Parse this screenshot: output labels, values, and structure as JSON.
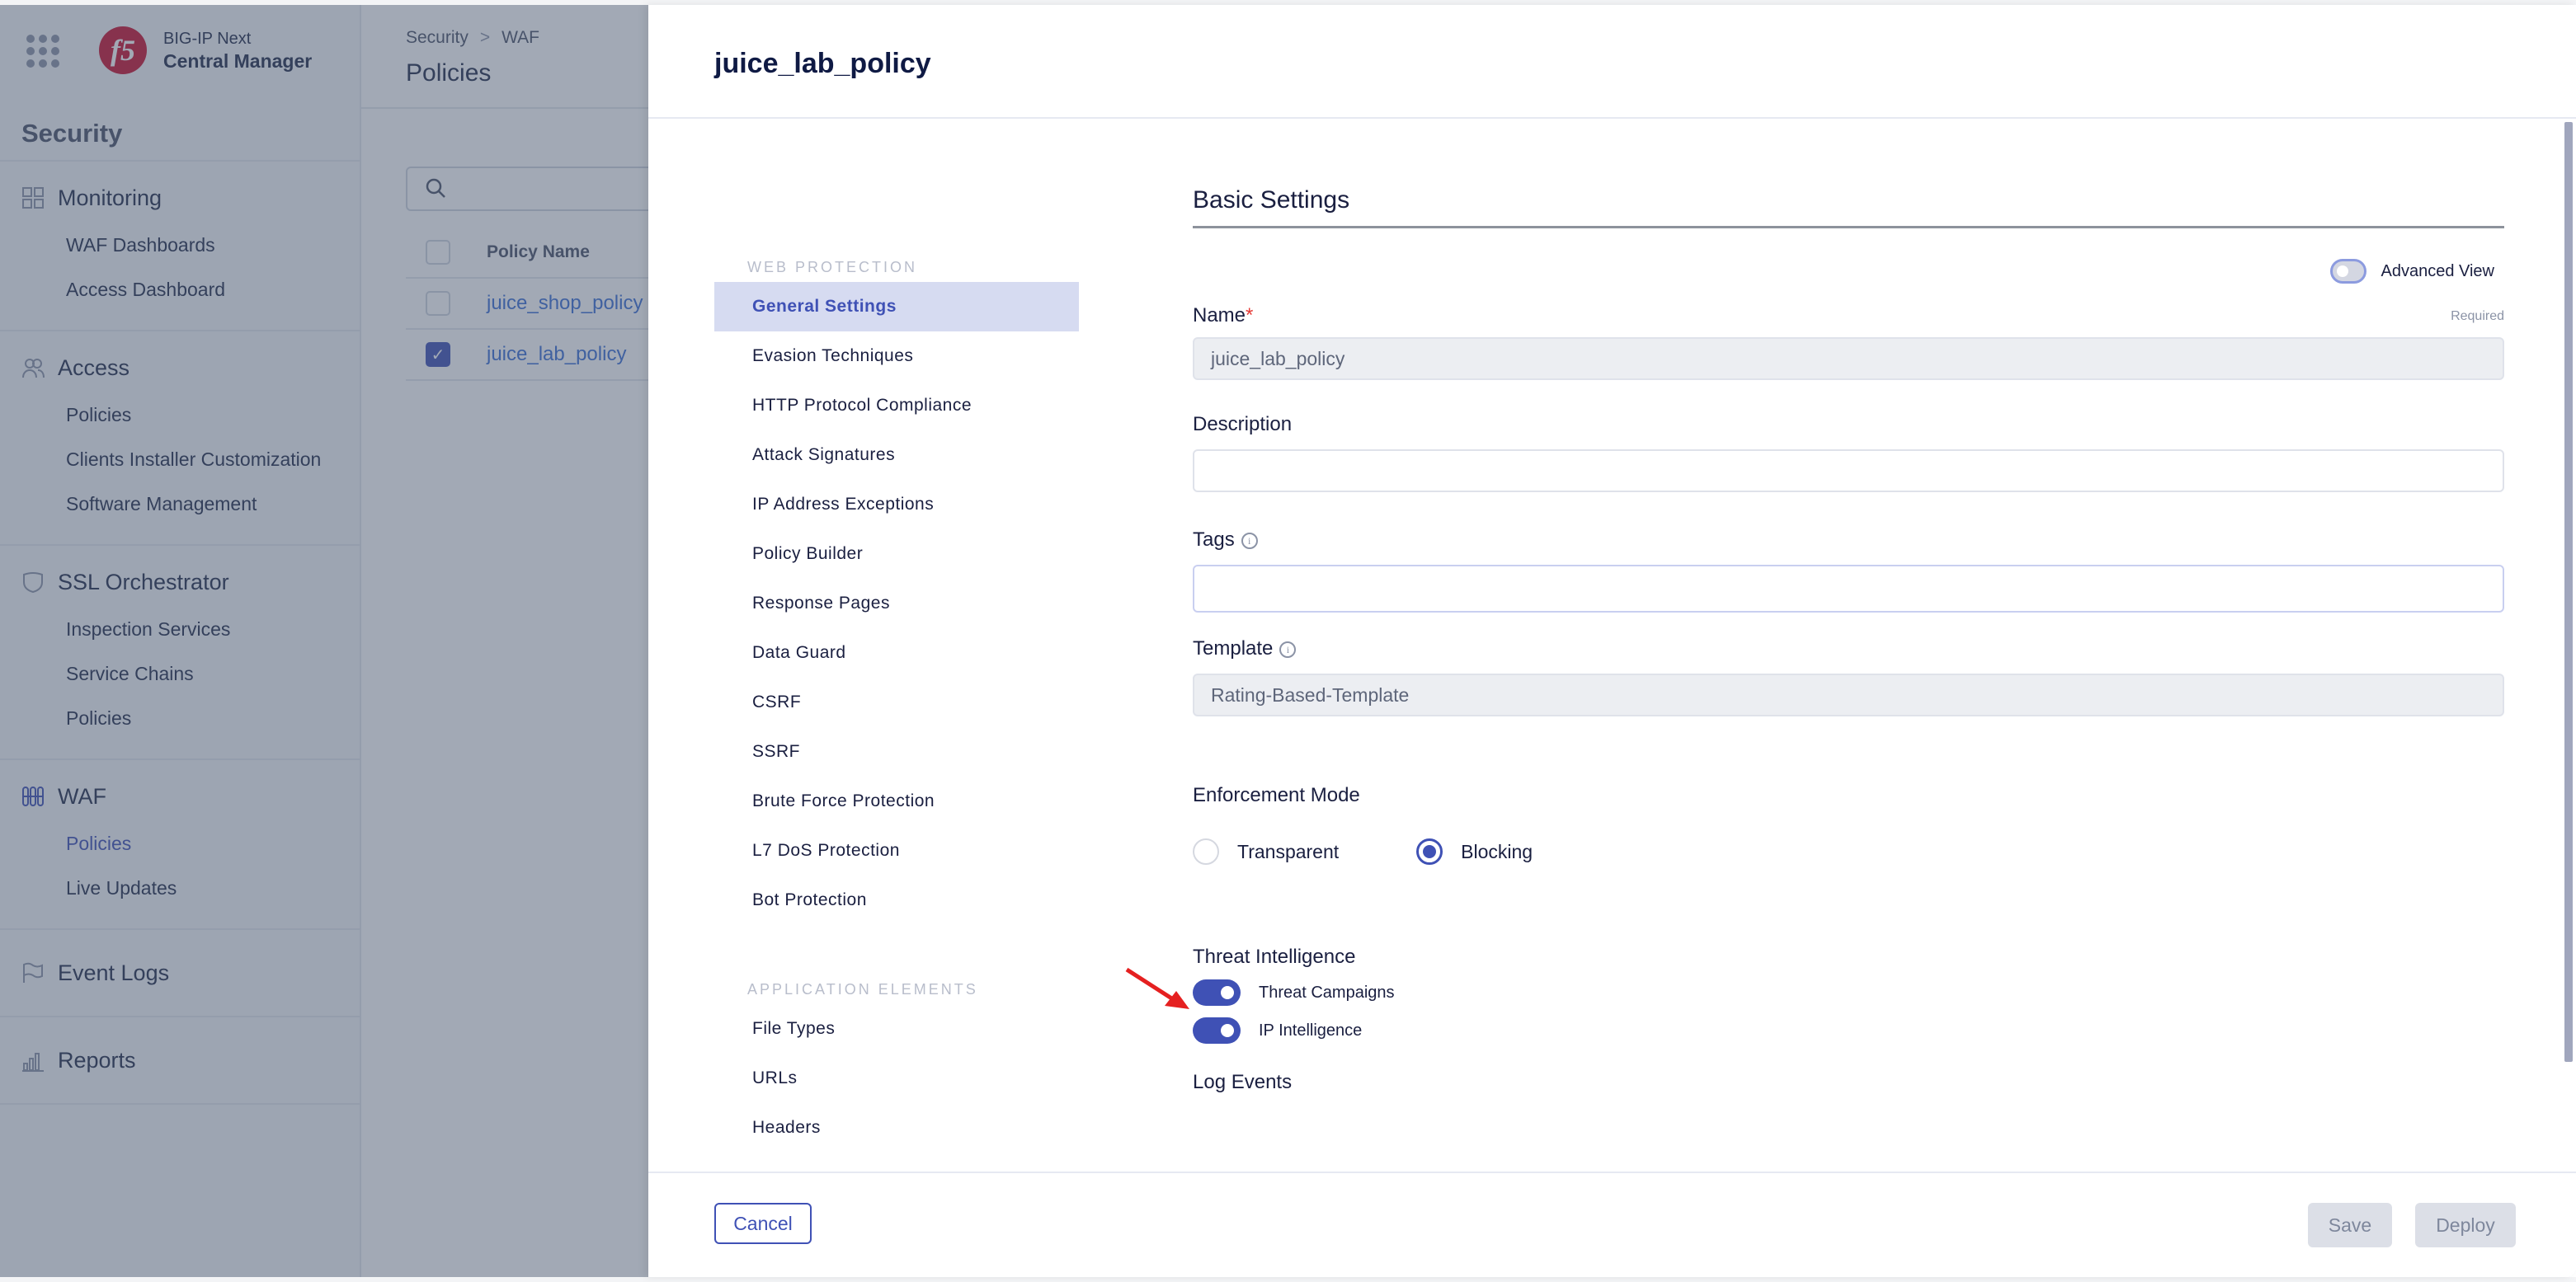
{
  "brand": {
    "line1": "BIG-IP Next",
    "line2": "Central Manager",
    "logo": "f5"
  },
  "sidebar": {
    "section_title": "Security",
    "groups": [
      {
        "label": "Monitoring",
        "icon": "grid-icon",
        "items": [
          {
            "label": "WAF Dashboards"
          },
          {
            "label": "Access Dashboard"
          }
        ]
      },
      {
        "label": "Access",
        "icon": "users-icon",
        "items": [
          {
            "label": "Policies"
          },
          {
            "label": "Clients Installer Customization"
          },
          {
            "label": "Software Management"
          }
        ]
      },
      {
        "label": "SSL Orchestrator",
        "icon": "shield-icon",
        "items": [
          {
            "label": "Inspection Services"
          },
          {
            "label": "Service Chains"
          },
          {
            "label": "Policies"
          }
        ]
      },
      {
        "label": "WAF",
        "icon": "waf-icon",
        "items": [
          {
            "label": "Policies",
            "active": true
          },
          {
            "label": "Live Updates"
          }
        ]
      },
      {
        "label": "Event Logs",
        "icon": "flag-icon",
        "items": []
      },
      {
        "label": "Reports",
        "icon": "bar-chart-icon",
        "items": []
      }
    ]
  },
  "page": {
    "breadcrumb": [
      "Security",
      "WAF"
    ],
    "breadcrumb_sep": ">",
    "title": "Policies",
    "search_placeholder": "",
    "table": {
      "header": "Policy Name",
      "rows": [
        {
          "name": "juice_shop_policy",
          "checked": false
        },
        {
          "name": "juice_lab_policy",
          "checked": true
        }
      ]
    }
  },
  "panel": {
    "title": "juice_lab_policy",
    "nav": {
      "web_protection_label": "WEB PROTECTION",
      "web_protection": [
        "General Settings",
        "Evasion Techniques",
        "HTTP Protocol Compliance",
        "Attack Signatures",
        "IP Address Exceptions",
        "Policy Builder",
        "Response Pages",
        "Data Guard",
        "CSRF",
        "SSRF",
        "Brute Force Protection",
        "L7 DoS Protection",
        "Bot Protection"
      ],
      "active": "General Settings",
      "application_elements_label": "APPLICATION ELEMENTS",
      "application_elements": [
        "File Types",
        "URLs",
        "Headers"
      ]
    },
    "section_title": "Basic Settings",
    "advanced_view": {
      "label": "Advanced View",
      "on": false
    },
    "name": {
      "label": "Name",
      "required_mark": "*",
      "required_text": "Required",
      "value": "juice_lab_policy"
    },
    "description": {
      "label": "Description",
      "value": ""
    },
    "tags": {
      "label": "Tags",
      "value": ""
    },
    "template": {
      "label": "Template",
      "value": "Rating-Based-Template"
    },
    "enforcement": {
      "label": "Enforcement Mode",
      "options": [
        "Transparent",
        "Blocking"
      ],
      "selected": "Blocking"
    },
    "threat_intel": {
      "label": "Threat Intelligence",
      "toggles": [
        {
          "label": "Threat Campaigns",
          "on": true
        },
        {
          "label": "IP Intelligence",
          "on": true
        }
      ]
    },
    "log_events": {
      "label": "Log Events"
    },
    "footer": {
      "cancel": "Cancel",
      "save": "Save",
      "deploy": "Deploy"
    }
  },
  "colors": {
    "accent": "#3f51b5",
    "annotation_arrow": "#e52020"
  }
}
